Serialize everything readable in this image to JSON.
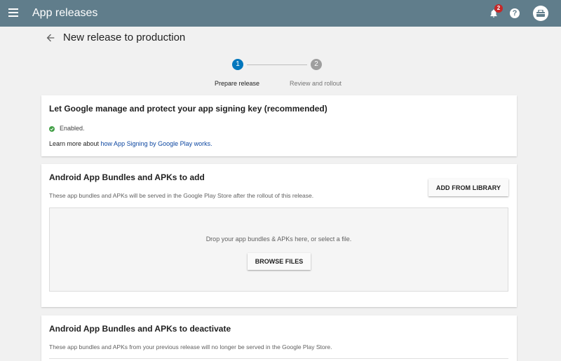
{
  "appbar": {
    "title": "App releases",
    "notification_count": "2",
    "help_symbol": "?",
    "color": "#607d8b"
  },
  "page": {
    "title": "New release to production"
  },
  "stepper": {
    "steps": [
      {
        "number": "1",
        "label": "Prepare release",
        "state": "active"
      },
      {
        "number": "2",
        "label": "Review and rollout",
        "state": "inactive"
      }
    ],
    "active_color": "#0277bd"
  },
  "signing_card": {
    "title": "Let Google manage and protect your app signing key (recommended)",
    "status": "Enabled.",
    "status_color": "#43a047",
    "learn_prefix": "Learn more about ",
    "learn_link": "how App Signing by Google Play works."
  },
  "add_card": {
    "title": "Android App Bundles and APKs to add",
    "description": "These app bundles and APKs will be served in the Google Play Store after the rollout of this release.",
    "library_button": "ADD FROM LIBRARY",
    "drop_text": "Drop your app bundles & APKs here, or select a file.",
    "browse_button": "BROWSE FILES"
  },
  "deactivate_card": {
    "title": "Android App Bundles and APKs to deactivate",
    "description": "These app bundles and APKs from your previous release will no longer be served in the Google Play Store."
  },
  "icons": {
    "menu": "menu-icon",
    "notifications": "bell-icon",
    "help": "help-icon",
    "account": "account-icon",
    "back": "arrow-back-icon",
    "enabled": "check-circle-icon"
  }
}
